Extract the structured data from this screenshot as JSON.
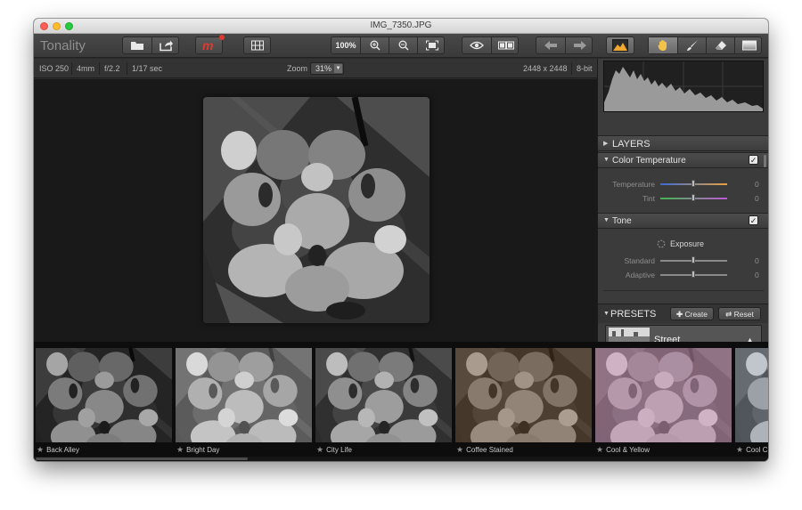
{
  "window": {
    "title": "IMG_7350.JPG"
  },
  "toolbar": {
    "app_name": "Tonality",
    "zoom_actual_label": "100%"
  },
  "info": {
    "iso": "ISO 250",
    "focal": "4mm",
    "aperture": "f/2.2",
    "shutter": "1/17 sec",
    "zoom_label": "Zoom",
    "zoom_value": "31%",
    "dimensions": "2448 x 2448",
    "bit_depth": "8-bit"
  },
  "panel": {
    "layers_title": "LAYERS",
    "color_temperature": {
      "title": "Color Temperature",
      "enabled": true,
      "sliders": [
        {
          "label": "Temperature",
          "value": "0"
        },
        {
          "label": "Tint",
          "value": "0"
        }
      ]
    },
    "tone": {
      "title": "Tone",
      "enabled": true,
      "exposure_label": "Exposure",
      "sliders": [
        {
          "label": "Standard",
          "value": "0"
        },
        {
          "label": "Adaptive",
          "value": "0"
        }
      ]
    },
    "presets": {
      "title": "PRESETS",
      "create_label": "Create",
      "reset_label": "Reset",
      "selected": "Street"
    }
  },
  "filmstrip": {
    "presets": [
      {
        "name": "Back Alley"
      },
      {
        "name": "Bright Day"
      },
      {
        "name": "City Life"
      },
      {
        "name": "Coffee Stained"
      },
      {
        "name": "Cool & Yellow"
      },
      {
        "name": "Cool C"
      }
    ]
  },
  "colors": {
    "accent_red": "#e03a2f",
    "temperature_track": "#e7a23f",
    "tint_track": "#c058d6",
    "cool_track": "#3a6bd8",
    "green_track": "#3fb84c"
  }
}
